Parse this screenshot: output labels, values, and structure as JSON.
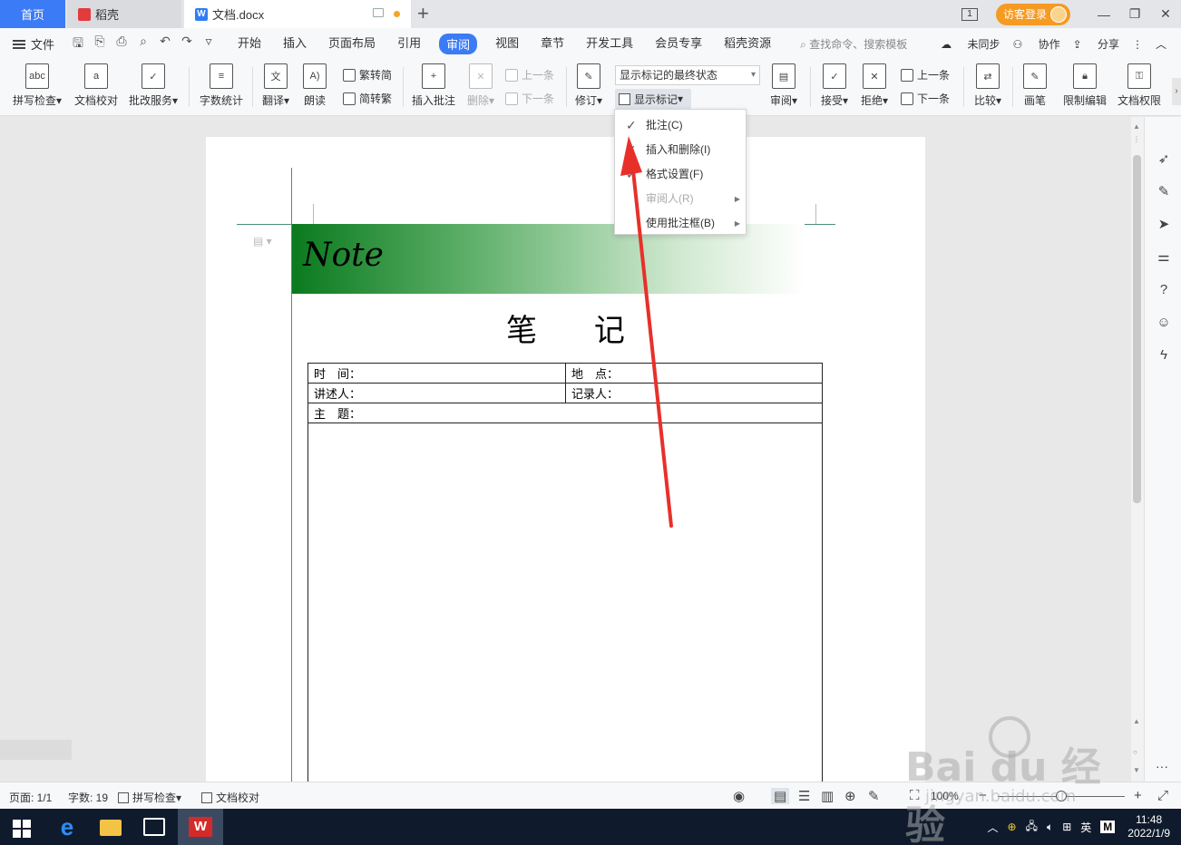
{
  "tabs": {
    "home": "首页",
    "daoke": "稻壳",
    "doc": "文档.docx",
    "add": "+"
  },
  "window": {
    "page_indicator": "1",
    "login": "访客登录",
    "minimize": "—",
    "restore": "❐",
    "close": "✕"
  },
  "menubar": {
    "file": "文件",
    "items": [
      "开始",
      "插入",
      "页面布局",
      "引用",
      "审阅",
      "视图",
      "章节",
      "开发工具",
      "会员专享",
      "稻壳资源"
    ],
    "active": "审阅",
    "search": "查找命令、搜索模板",
    "sync": "未同步",
    "collab": "协作",
    "share": "分享"
  },
  "ribbon": {
    "spell": "拼写检查",
    "proof": "文档校对",
    "correct": "批改服务",
    "wordcount": "字数统计",
    "translate": "翻译",
    "read": "朗读",
    "trad": "繁转简",
    "simp": "简转繁",
    "insert_comment": "插入批注",
    "delete": "删除",
    "prev": "上一条",
    "next": "下一条",
    "revise": "修订",
    "markup_state": "显示标记的最终状态",
    "show_marks": "显示标记",
    "review": "审阅",
    "accept": "接受",
    "reject": "拒绝",
    "prev2": "上一条",
    "next2": "下一条",
    "compare": "比较",
    "pen": "画笔",
    "restrict": "限制编辑",
    "permission": "文档权限"
  },
  "dropdown": {
    "items": [
      {
        "label": "批注(C)",
        "checked": true,
        "disabled": false,
        "submenu": false
      },
      {
        "label": "插入和删除(I)",
        "checked": true,
        "disabled": false,
        "submenu": false
      },
      {
        "label": "格式设置(F)",
        "checked": true,
        "disabled": false,
        "submenu": false
      },
      {
        "label": "审阅人(R)",
        "checked": false,
        "disabled": true,
        "submenu": true
      },
      {
        "label": "使用批注框(B)",
        "checked": false,
        "disabled": false,
        "submenu": true
      }
    ]
  },
  "document": {
    "banner": "Note",
    "title": "笔 记",
    "table": {
      "time": "时　间：",
      "place": "地　点：",
      "speaker": "讲述人：",
      "recorder": "记录人：",
      "topic": "主　题："
    }
  },
  "statusbar": {
    "page": "页面: 1/1",
    "words": "字数: 19",
    "spell": "拼写检查",
    "proof": "文档校对",
    "zoom": "100%"
  },
  "taskbar": {
    "time": "11:48",
    "date": "2022/1/9",
    "ime": "英",
    "m": "M"
  },
  "watermark": {
    "brand": "Bai du 经验",
    "url": "jingyan.baidu.com"
  },
  "colors": {
    "accent": "#3c7bf6",
    "login": "#f59a23",
    "arrow": "#e8302a",
    "banner_start": "#0a7a1e"
  }
}
